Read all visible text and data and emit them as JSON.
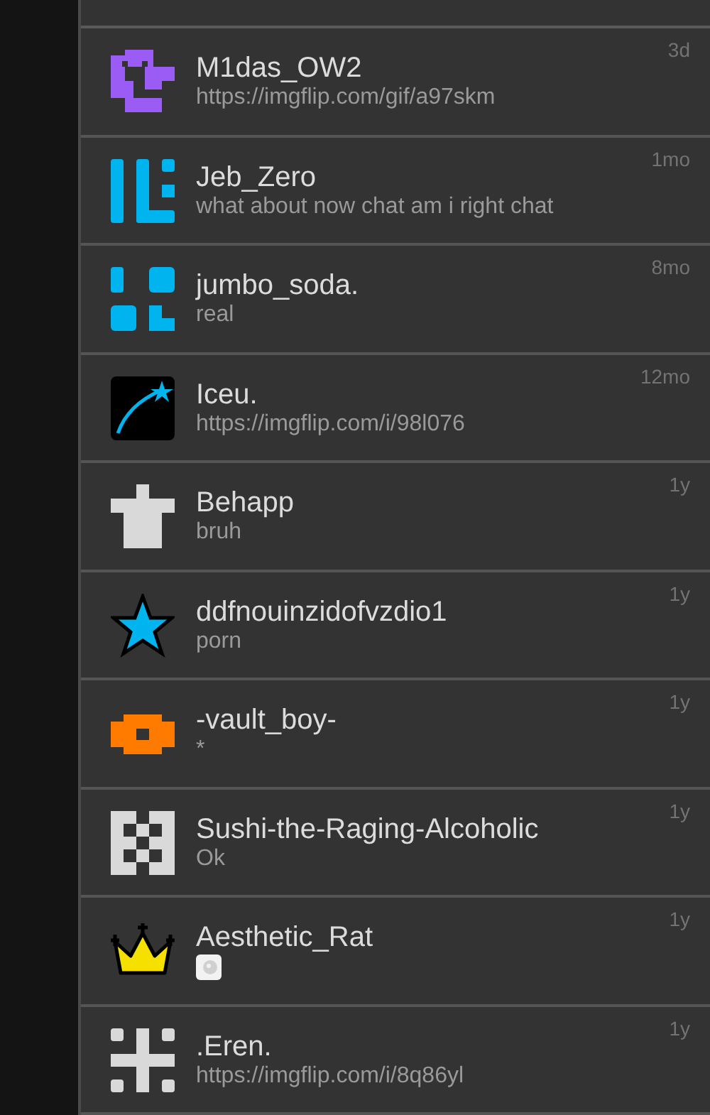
{
  "conversations": [
    {
      "name": "M1das_OW2",
      "preview": {
        "kind": "text",
        "text": "https://imgflip.com/gif/a97skm"
      },
      "time": "3d"
    },
    {
      "name": "Jeb_Zero",
      "preview": {
        "kind": "text",
        "text": "what about now chat am i right chat"
      },
      "time": "1mo"
    },
    {
      "name": "jumbo_soda.",
      "preview": {
        "kind": "text",
        "text": "real"
      },
      "time": "8mo"
    },
    {
      "name": "Iceu.",
      "preview": {
        "kind": "text",
        "text": "https://imgflip.com/i/98l076"
      },
      "time": "12mo"
    },
    {
      "name": "Behapp",
      "preview": {
        "kind": "text",
        "text": "bruh"
      },
      "time": "1y"
    },
    {
      "name": "ddfnouinzidofvzdio1",
      "preview": {
        "kind": "text",
        "text": "porn"
      },
      "time": "1y"
    },
    {
      "name": "-vault_boy-",
      "preview": {
        "kind": "text",
        "text": "*"
      },
      "time": "1y"
    },
    {
      "name": "Sushi-the-Raging-Alcoholic",
      "preview": {
        "kind": "text",
        "text": "Ok"
      },
      "time": "1y"
    },
    {
      "name": "Aesthetic_Rat",
      "preview": {
        "kind": "image"
      },
      "time": "1y"
    },
    {
      "name": ".Eren.",
      "preview": {
        "kind": "text",
        "text": "https://imgflip.com/i/8q86yl"
      },
      "time": "1y"
    }
  ]
}
